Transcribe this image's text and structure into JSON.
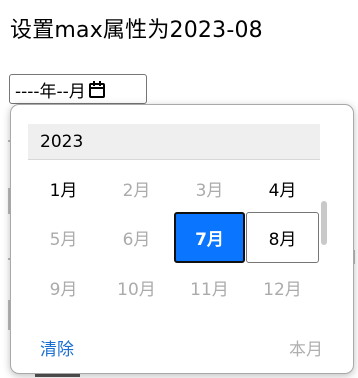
{
  "page": {
    "title": "设置max属性为2023-08"
  },
  "month_input": {
    "display_text": "----年--月",
    "icon": "calendar-icon"
  },
  "picker": {
    "year": "2023",
    "months": [
      {
        "label": "1月",
        "state": "enabled"
      },
      {
        "label": "2月",
        "state": "disabled"
      },
      {
        "label": "3月",
        "state": "disabled"
      },
      {
        "label": "4月",
        "state": "enabled"
      },
      {
        "label": "5月",
        "state": "disabled"
      },
      {
        "label": "6月",
        "state": "disabled"
      },
      {
        "label": "7月",
        "state": "selected"
      },
      {
        "label": "8月",
        "state": "outlined"
      },
      {
        "label": "9月",
        "state": "disabled"
      },
      {
        "label": "10月",
        "state": "disabled"
      },
      {
        "label": "11月",
        "state": "disabled"
      },
      {
        "label": "12月",
        "state": "disabled"
      }
    ],
    "clear_label": "清除",
    "this_month_label": "本月"
  },
  "colors": {
    "selected_bg": "#0a75ff",
    "link": "#1a6fd0",
    "disabled_text": "#ababab"
  }
}
